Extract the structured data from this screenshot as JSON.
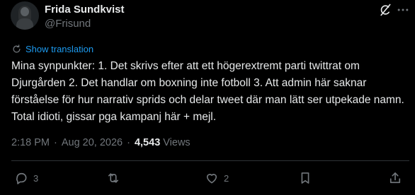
{
  "author": {
    "name": "Frida Sundkvist",
    "handle": "@Frisund"
  },
  "translation_link": "Show translation",
  "tweet_text": "Mina synpunkter: 1. Det skrivs efter att ett högerextremt parti twittrat om Djurgården 2. Det handlar om boxning inte fotboll 3. Att admin här saknar förståelse för hur narrativ sprids och delar tweet där man lätt ser utpekade namn. Total idioti, gissar pga kampanj här + mejl.",
  "meta": {
    "time": "2:18 PM",
    "separator": "·",
    "date": "Aug 20, 2026",
    "views_count": "4,543",
    "views_label": "Views"
  },
  "actions": {
    "replies": "3",
    "likes": "2"
  },
  "icons": {
    "grok": "grok-icon",
    "more": "more-icon",
    "translate": "globe-icon",
    "reply": "reply-icon",
    "retweet": "retweet-icon",
    "like": "heart-icon",
    "bookmark": "bookmark-icon",
    "share": "share-icon"
  },
  "colors": {
    "background": "#000000",
    "text": "#e7e9ea",
    "muted": "#71767b",
    "accent": "#1d9bf0",
    "divider": "#2f3336"
  }
}
